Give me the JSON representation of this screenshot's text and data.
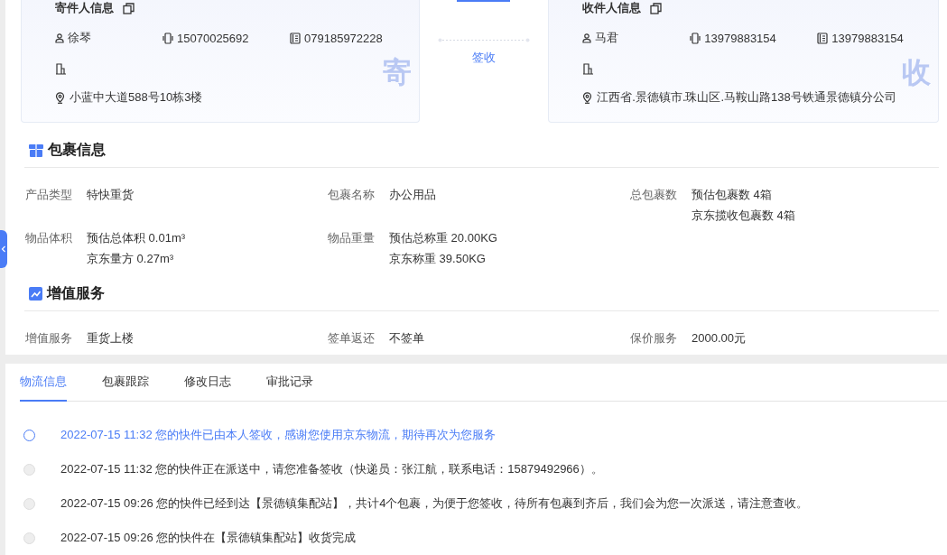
{
  "sender": {
    "title": "寄件人信息",
    "name": "徐琴",
    "mobile": "15070025692",
    "phone": "079185972228",
    "address": "小蓝中大道588号10栋3楼",
    "stamp": "寄"
  },
  "connector": {
    "status": "签收"
  },
  "receiver": {
    "title": "收件人信息",
    "name": "马君",
    "mobile": "13979883154",
    "phone": "13979883154",
    "address": "江西省.景德镇市.珠山区.马鞍山路138号铁通景德镇分公司",
    "stamp": "收"
  },
  "package": {
    "title": "包裹信息",
    "fields": [
      {
        "label": "产品类型",
        "values": [
          "特快重货"
        ]
      },
      {
        "label": "包裹名称",
        "values": [
          "办公用品"
        ]
      },
      {
        "label": "总包裹数",
        "values": [
          "预估包裹数 4箱",
          "京东揽收包裹数 4箱"
        ]
      },
      {
        "label": "物品体积",
        "values": [
          "预估总体积 0.01m³",
          "京东量方 0.27m³"
        ]
      },
      {
        "label": "物品重量",
        "values": [
          "预估总称重 20.00KG",
          "京东称重 39.50KG"
        ]
      }
    ]
  },
  "value_added": {
    "title": "增值服务",
    "fields": [
      {
        "label": "增值服务",
        "values": [
          "重货上楼"
        ]
      },
      {
        "label": "签单返还",
        "values": [
          "不签单"
        ]
      },
      {
        "label": "保价服务",
        "values": [
          "2000.00元"
        ]
      }
    ]
  },
  "tabs": [
    {
      "label": "物流信息",
      "selected": true
    },
    {
      "label": "包裹跟踪",
      "selected": false
    },
    {
      "label": "修改日志",
      "selected": false
    },
    {
      "label": "审批记录",
      "selected": false
    }
  ],
  "timeline": [
    {
      "text": "2022-07-15 11:32 您的快件已由本人签收，感谢您使用京东物流，期待再次为您服务",
      "current": true
    },
    {
      "text": "2022-07-15 11:32 您的快件正在派送中，请您准备签收（快递员：张江航，联系电话：15879492966）。",
      "current": false
    },
    {
      "text": "2022-07-15 09:26 您的快件已经到达【景德镇集配站】，共计4个包裹，为便于您签收，待所有包裹到齐后，我们会为您一次派送，请注意查收。",
      "current": false
    },
    {
      "text": "2022-07-15 09:26 您的快件在【景德镇集配站】收货完成",
      "current": false
    }
  ]
}
